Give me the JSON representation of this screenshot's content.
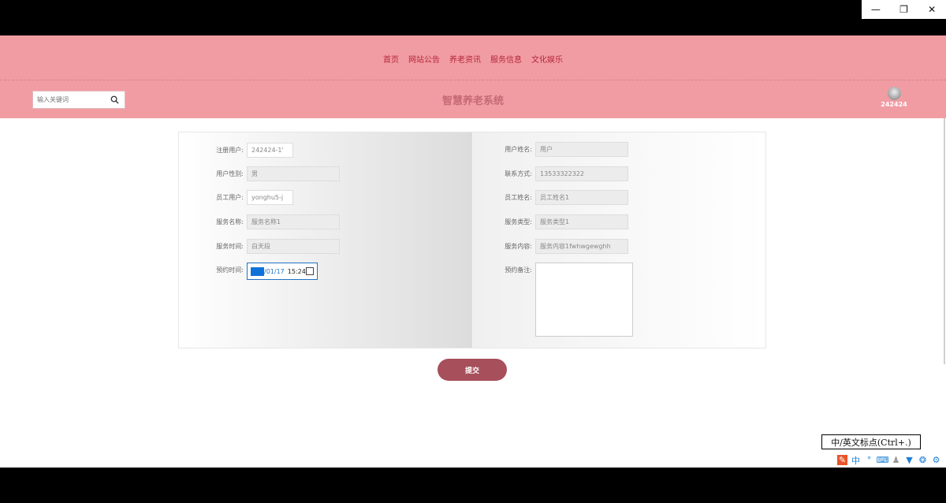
{
  "window": {
    "minimize": "—",
    "restore": "❐",
    "close": "✕"
  },
  "nav": {
    "links": [
      "首页",
      "网站公告",
      "养老资讯",
      "服务信息",
      "文化娱乐"
    ]
  },
  "header": {
    "search_placeholder": "输入关键词",
    "site_title": "智慧养老系统",
    "user_name": "242424"
  },
  "form": {
    "left": [
      {
        "label": "注册用户:",
        "value": "242424-1'"
      },
      {
        "label": "用户性别:",
        "value": "男"
      },
      {
        "label": "员工用户:",
        "value": "yonghu5-j"
      },
      {
        "label": "服务名称:",
        "value": "服务名称1"
      },
      {
        "label": "服务时间:",
        "value": "白天段"
      },
      {
        "label": "预约时间:",
        "date": "/01/17",
        "time": "15:24"
      }
    ],
    "right": [
      {
        "label": "用户姓名:",
        "value": "用户"
      },
      {
        "label": "联系方式:",
        "value": "13533322322"
      },
      {
        "label": "员工姓名:",
        "value": "员工姓名1"
      },
      {
        "label": "服务类型:",
        "value": "服务类型1"
      },
      {
        "label": "服务内容:",
        "value": "服务内容1fwhwgewghh"
      },
      {
        "label": "预约备注:",
        "value": ""
      }
    ],
    "submit": "提交"
  },
  "ime": {
    "tip": "中/英文标点(Ctrl+.)",
    "lang": "中",
    "dot": "°"
  }
}
